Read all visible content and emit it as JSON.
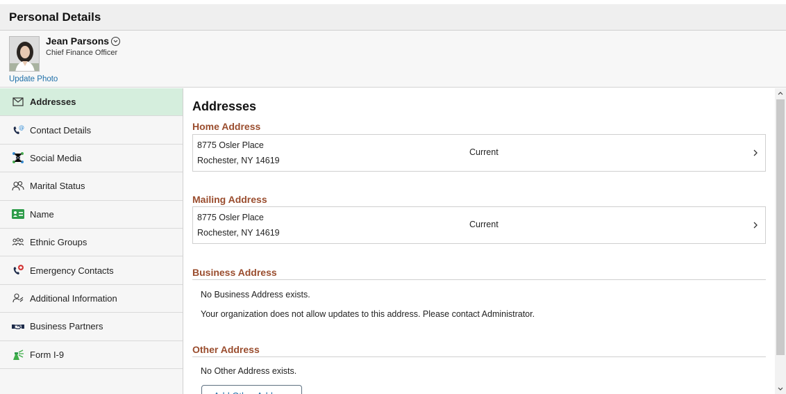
{
  "page": {
    "title": "Personal Details"
  },
  "profile": {
    "name": "Jean Parsons",
    "job_title": "Chief Finance Officer",
    "update_photo_label": "Update Photo"
  },
  "sidebar": {
    "items": [
      {
        "label": "Addresses",
        "icon": "envelope-icon",
        "active": true
      },
      {
        "label": "Contact Details",
        "icon": "phone-at-icon"
      },
      {
        "label": "Social Media",
        "icon": "social-network-icon"
      },
      {
        "label": "Marital Status",
        "icon": "two-people-icon"
      },
      {
        "label": "Name",
        "icon": "id-card-icon"
      },
      {
        "label": "Ethnic Groups",
        "icon": "group-icon"
      },
      {
        "label": "Emergency Contacts",
        "icon": "emergency-phone-icon"
      },
      {
        "label": "Additional Information",
        "icon": "person-info-icon"
      },
      {
        "label": "Business Partners",
        "icon": "handshake-icon"
      },
      {
        "label": "Form I-9",
        "icon": "form-i9-icon"
      }
    ]
  },
  "main": {
    "heading": "Addresses",
    "home": {
      "title": "Home Address",
      "line1": "8775 Osler Place",
      "line2": "Rochester, NY 14619",
      "status": "Current"
    },
    "mailing": {
      "title": "Mailing Address",
      "line1": "8775 Osler Place",
      "line2": "Rochester, NY 14619",
      "status": "Current"
    },
    "business": {
      "title": "Business Address",
      "message1": "No Business Address exists.",
      "message2": "Your organization does not allow updates to this address. Please contact Administrator."
    },
    "other": {
      "title": "Other Address",
      "message": "No Other Address exists.",
      "add_button_label": "Add Other Address"
    }
  },
  "colors": {
    "accent_active": "#d5eedd",
    "section_title": "#9a4d2e",
    "link": "#1e6fa8"
  }
}
